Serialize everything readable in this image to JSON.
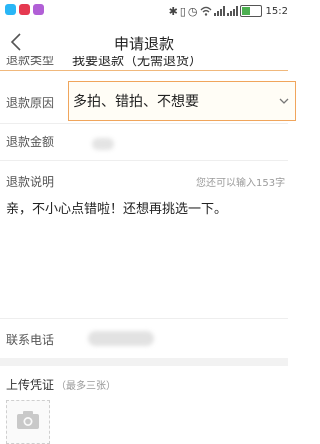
{
  "status_bar": {
    "time": "15:2",
    "app_icons": [
      "app-icon-1",
      "app-icon-2",
      "app-icon-3"
    ],
    "indicators": [
      "bluetooth-icon",
      "vibrate-icon",
      "alarm-icon",
      "wifi-icon",
      "signal-icon",
      "battery-icon"
    ]
  },
  "header": {
    "title": "申请退款",
    "back_icon": "chevron-left-icon"
  },
  "form": {
    "refund_type": {
      "label": "退款类型",
      "value": "我要退款（无需退货）"
    },
    "refund_reason": {
      "label": "退款原因",
      "value": "多拍、错拍、不想要"
    },
    "refund_amount": {
      "label": "退款金额"
    },
    "refund_desc": {
      "label": "退款说明",
      "hint": "您还可以输入153字",
      "value": "亲，不小心点错啦！还想再挑选一下。"
    },
    "phone": {
      "label": "联系电话"
    },
    "upload": {
      "label": "上传凭证",
      "sublabel": "（最多三张）"
    }
  },
  "colors": {
    "accent_border": "#f0a55c",
    "text_primary": "#222222",
    "text_secondary": "#555555",
    "hint": "#9a9a9a"
  }
}
